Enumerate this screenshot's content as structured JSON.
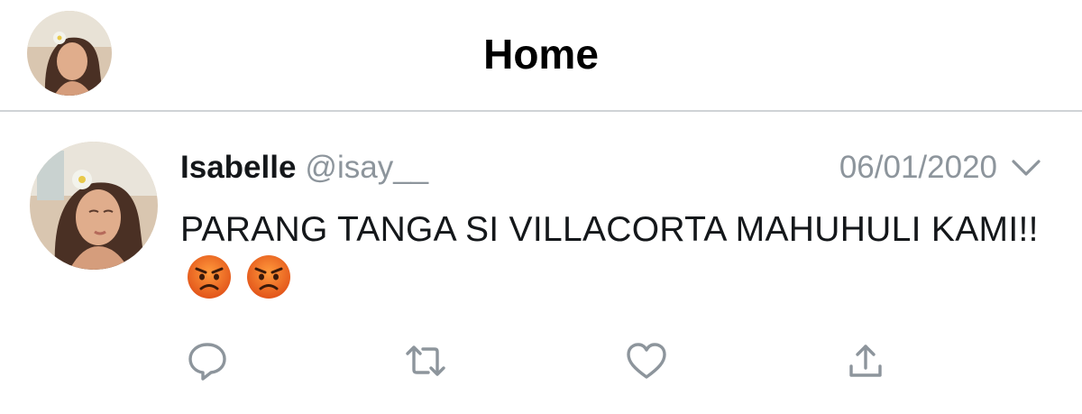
{
  "header": {
    "title": "Home"
  },
  "tweet": {
    "display_name": "Isabelle",
    "handle": "@isay__",
    "date": "06/01/2020",
    "text": "PARANG TANGA SI VILLACORTA MAHUHULI KAMI!!",
    "emojis": [
      "angry-face",
      "angry-face"
    ]
  },
  "actions": [
    "reply-icon",
    "retweet-icon",
    "like-icon",
    "share-icon"
  ],
  "colors": {
    "icon_gray": "#8d959c",
    "divider": "#cfd3d6",
    "text": "#14171a"
  }
}
